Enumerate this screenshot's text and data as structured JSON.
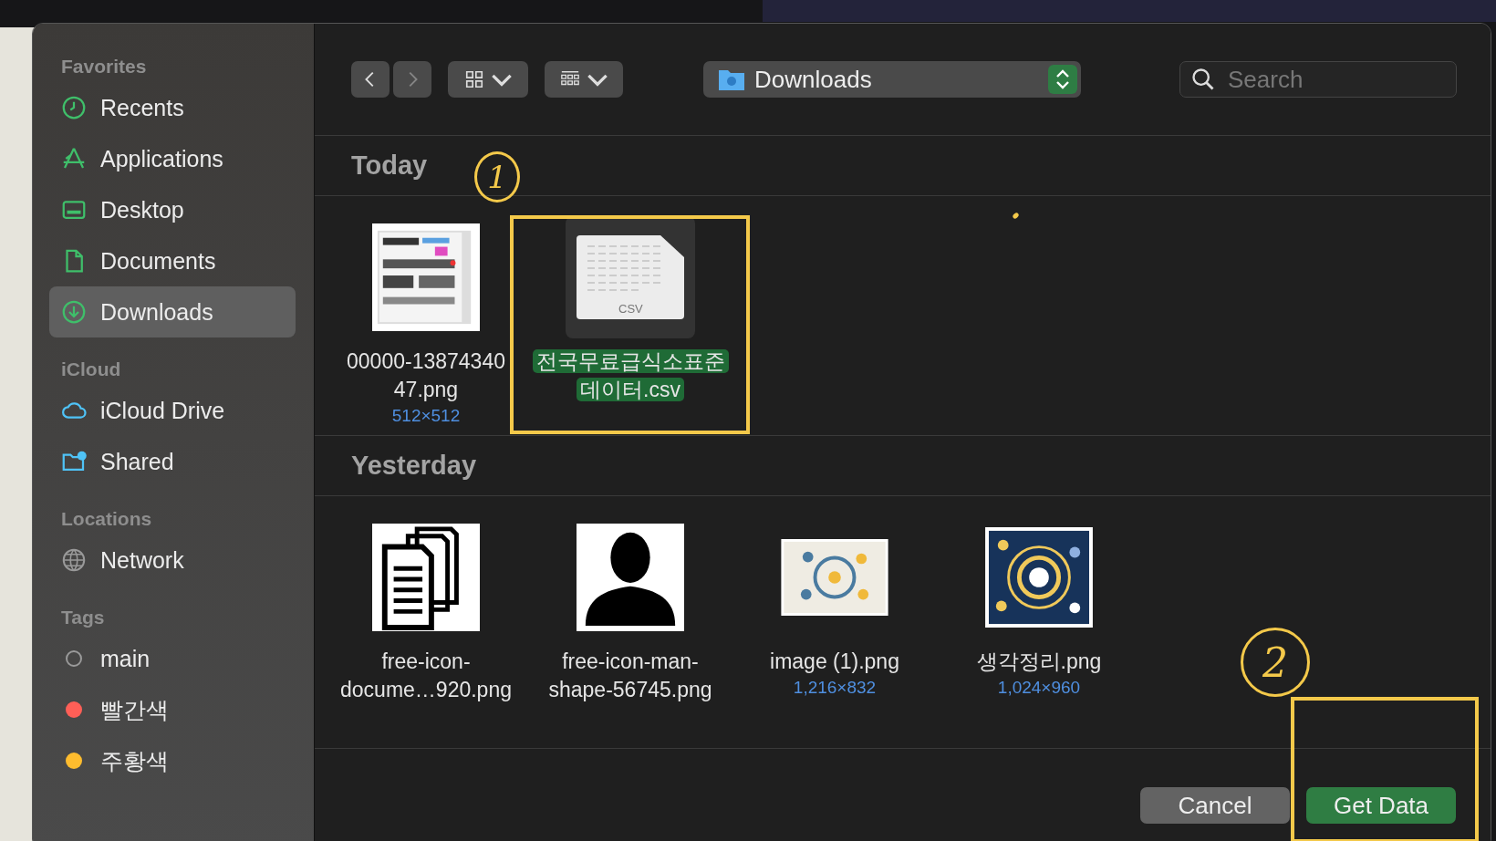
{
  "sidebar": {
    "sections": [
      {
        "title": "Favorites",
        "items": [
          {
            "label": "Recents",
            "kind": "place",
            "selected": false
          },
          {
            "label": "Applications",
            "kind": "place",
            "selected": false
          },
          {
            "label": "Desktop",
            "kind": "place",
            "selected": false
          },
          {
            "label": "Documents",
            "kind": "place",
            "selected": false
          },
          {
            "label": "Downloads",
            "kind": "place",
            "selected": true
          }
        ]
      },
      {
        "title": "iCloud",
        "items": [
          {
            "label": "iCloud Drive",
            "kind": "place",
            "selected": false
          },
          {
            "label": "Shared",
            "kind": "place",
            "selected": false
          }
        ]
      },
      {
        "title": "Locations",
        "items": [
          {
            "label": "Network",
            "kind": "place",
            "selected": false
          }
        ]
      },
      {
        "title": "Tags",
        "items": [
          {
            "label": "main",
            "kind": "tag",
            "selected": false
          },
          {
            "label": "빨간색",
            "kind": "tag",
            "color": "#ff5f57",
            "selected": false
          },
          {
            "label": "주황색",
            "kind": "tag",
            "color": "#febc2e",
            "selected": false
          }
        ]
      }
    ]
  },
  "toolbar": {
    "back_disabled": false,
    "forward_disabled": true,
    "location": "Downloads",
    "search": {
      "placeholder": "Search"
    }
  },
  "groups": [
    {
      "title": "Today",
      "files": [
        {
          "name": "00000-1387434047.png",
          "dims": "512×512",
          "kind": "screenshot",
          "selected": false
        },
        {
          "name": "전국무료급식소표준데이터.csv",
          "kind": "csv",
          "badge": "CSV",
          "selected": true
        }
      ]
    },
    {
      "title": "Yesterday",
      "files": [
        {
          "name": "free-icon-docume…920.png",
          "kind": "documents",
          "selected": false
        },
        {
          "name": "free-icon-man-shape-56745.png",
          "kind": "person",
          "selected": false
        },
        {
          "name": "image (1).png",
          "dims": "1,216×832",
          "kind": "diagram-light",
          "selected": false
        },
        {
          "name": "생각정리.png",
          "dims": "1,024×960",
          "kind": "diagram-dark",
          "selected": false
        }
      ]
    }
  ],
  "buttons": [
    {
      "label": "Cancel",
      "kind": "secondary"
    },
    {
      "label": "Get Data",
      "kind": "primary"
    }
  ],
  "annotations": [
    {
      "label": "1"
    },
    {
      "label": "2"
    }
  ]
}
